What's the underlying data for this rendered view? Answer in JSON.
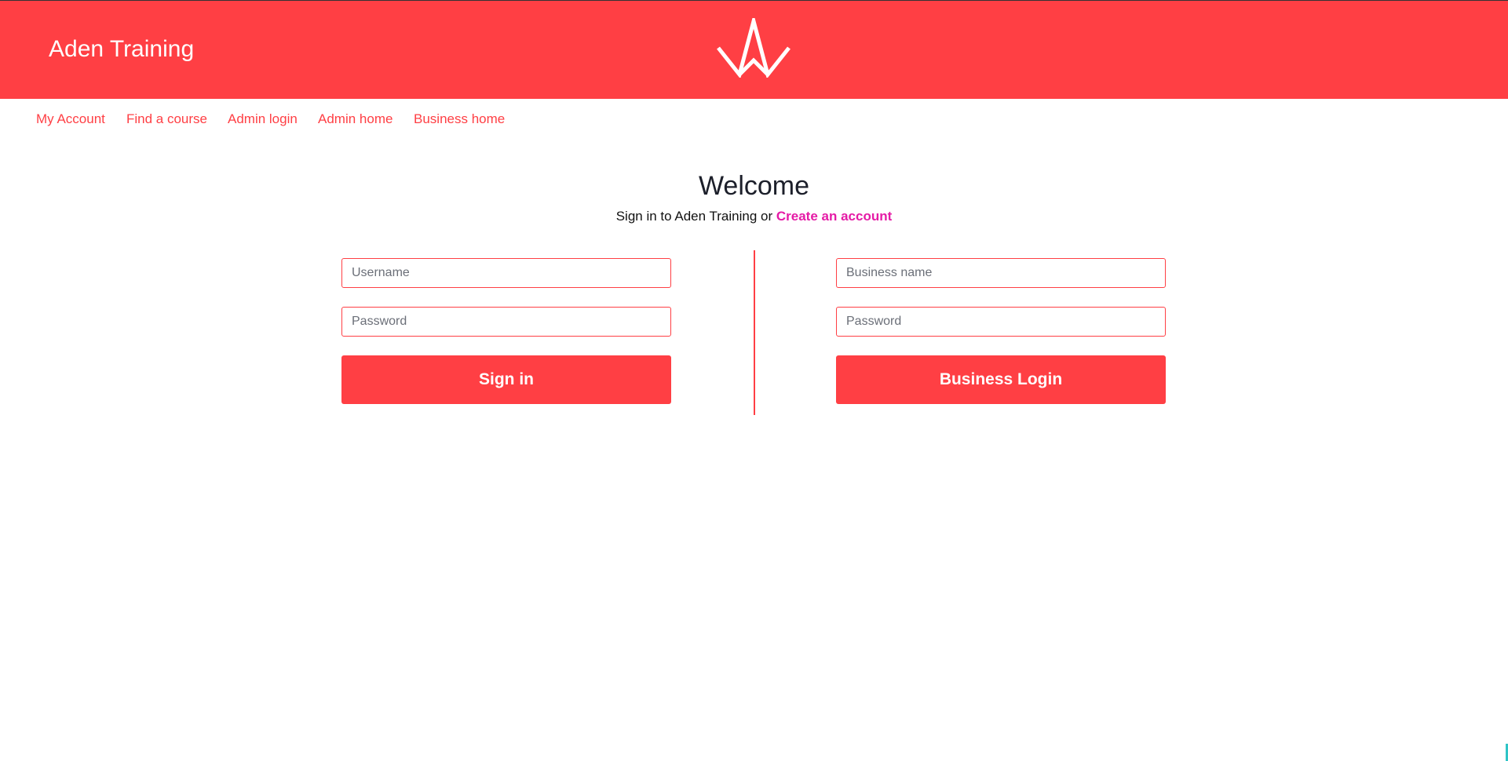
{
  "header": {
    "brand": "Aden Training",
    "logo_icon": "crown-logo-icon",
    "background": "#ff3f44"
  },
  "nav": {
    "items": [
      {
        "label": "My Account"
      },
      {
        "label": "Find a course"
      },
      {
        "label": "Admin login"
      },
      {
        "label": "Admin home"
      },
      {
        "label": "Business home"
      }
    ]
  },
  "welcome": {
    "title": "Welcome",
    "subtitle_prefix": "Sign in to Aden Training or",
    "create_account_link": "Create an account"
  },
  "user_login": {
    "username_placeholder": "Username",
    "username_value": "",
    "password_placeholder": "Password",
    "password_value": "",
    "submit_label": "Sign in"
  },
  "business_login": {
    "business_name_placeholder": "Business name",
    "business_name_value": "",
    "password_placeholder": "Password",
    "password_value": "",
    "submit_label": "Business Login"
  },
  "colors": {
    "accent": "#ff3f44",
    "link_highlight": "#e51ba6",
    "title_text": "#1c1f2a"
  }
}
